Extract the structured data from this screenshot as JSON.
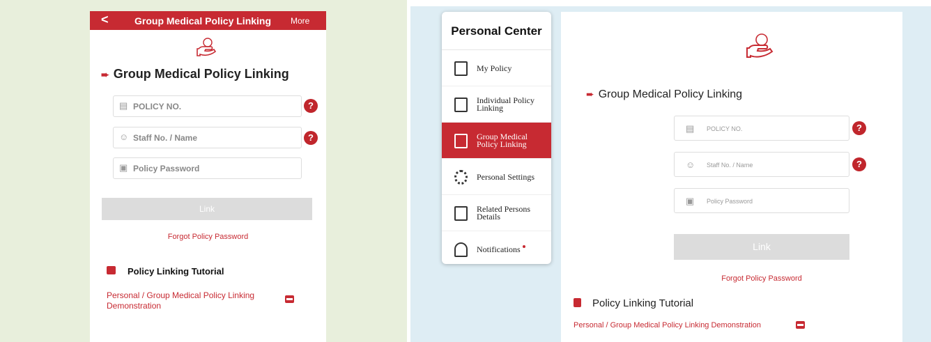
{
  "mobile": {
    "header": {
      "back": "<",
      "title": "Group Medical Policy Linking",
      "more": "More"
    },
    "heading": "Group Medical Policy Linking",
    "fields": {
      "policy_no": {
        "placeholder": "POLICY NO.",
        "icon": "document-icon"
      },
      "staff": {
        "placeholder": "Staff No. / Name",
        "icon": "user-icon"
      },
      "password": {
        "placeholder": "Policy Password",
        "icon": "lock-icon"
      }
    },
    "help": "?",
    "link_button": "Link",
    "forgot": "Forgot Policy Password",
    "tutorial_title": "Policy Linking Tutorial",
    "demo_link": "Personal / Group Medical Policy Linking Demonstration"
  },
  "sidebar": {
    "title": "Personal Center",
    "items": [
      {
        "label": "My Policy",
        "icon": "policy-icon",
        "active": false
      },
      {
        "label": "Individual Policy Linking",
        "icon": "individual-link-icon",
        "active": false
      },
      {
        "label": "Group Medical Policy Linking",
        "icon": "group-link-icon",
        "active": true
      },
      {
        "label": "Personal Settings",
        "icon": "gear-icon",
        "active": false
      },
      {
        "label": "Related Persons Details",
        "icon": "persons-icon",
        "active": false
      },
      {
        "label": "Notifications",
        "icon": "bell-icon",
        "active": false
      }
    ]
  },
  "desktop": {
    "heading": "Group Medical Policy Linking",
    "fields": {
      "policy_no": {
        "placeholder": "POLICY NO."
      },
      "staff": {
        "placeholder": "Staff No. / Name"
      },
      "password": {
        "placeholder": "Policy Password"
      }
    },
    "help": "?",
    "link_button": "Link",
    "forgot": "Forgot Policy Password",
    "tutorial_title": "Policy Linking Tutorial",
    "demo_link": "Personal / Group Medical Policy Linking Demonstration"
  },
  "colors": {
    "brand": "#c72a32",
    "left_bg": "#e8efdc",
    "right_bg": "#deedf4",
    "disabled": "#dcdcdc"
  }
}
